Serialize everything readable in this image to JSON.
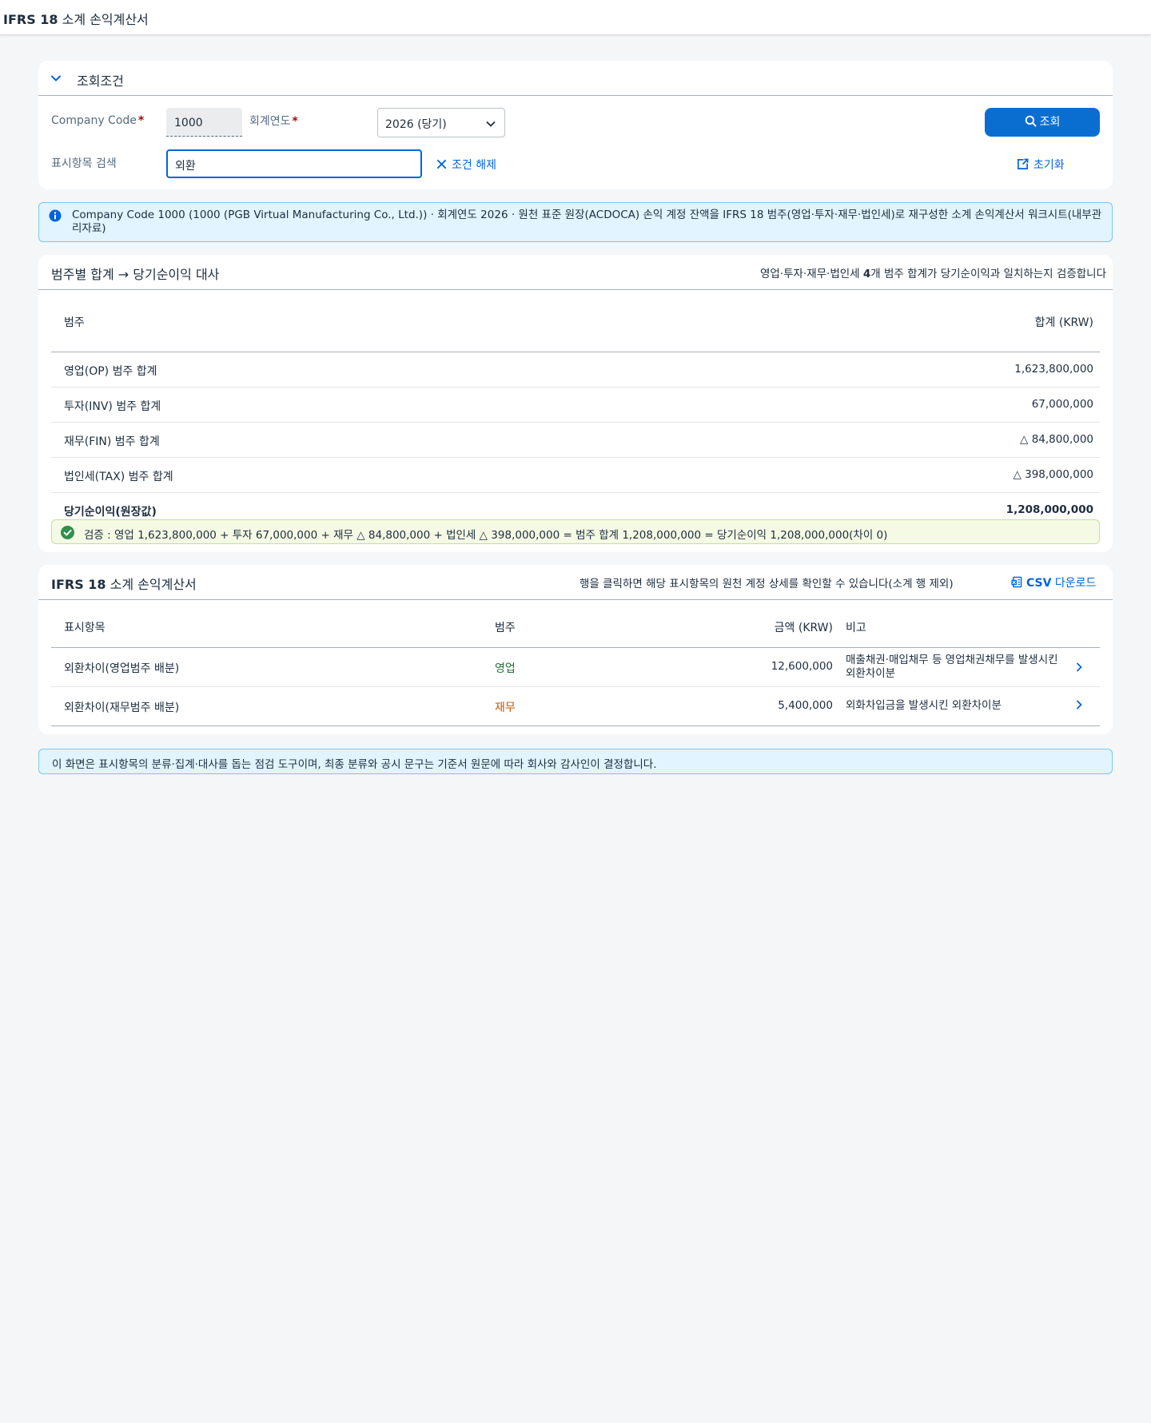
{
  "app": {
    "title_bold": "IFRS 18",
    "title_rest": "소계 손익계산서"
  },
  "filter": {
    "title": "조회조건",
    "company_code_label": "Company Code",
    "company_code_value": "1000",
    "fiscal_year_label": "회계연도",
    "fiscal_year_value": "2026 (당기)",
    "search_button_label": "조회",
    "item_search_label": "표시항목 검색",
    "item_search_value": "외환",
    "clear_label": "조건 해제",
    "reset_label": "초기화",
    "required_mark": "*"
  },
  "info": {
    "text": "Company Code 1000 (1000 (PGB Virtual Manufacturing Co., Ltd.)) · 회계연도 2026 · 원천 표준 원장(ACDOCA) 손익 계정 잔액을 IFRS 18 범주(영업·투자·재무·법인세)로 재구성한 소계 손익계산서 워크시트(내부관리자료)"
  },
  "reconciliation": {
    "title": "범주별 합계 → 당기순이익 대사",
    "note_prefix": "영업·투자·재무·법인세 ",
    "note_count": "4",
    "note_suffix": "개 범주 합계가 당기순이익과 일치하는지 검증합니다",
    "columns": {
      "category": "범주",
      "total": "합계 (KRW)"
    },
    "rows": [
      {
        "label": "영업(OP) 범주 합계",
        "value": "1,623,800,000"
      },
      {
        "label": "투자(INV) 범주 합계",
        "value": "67,000,000"
      },
      {
        "label": "재무(FIN) 범주 합계",
        "value": "△ 84,800,000"
      },
      {
        "label": "법인세(TAX) 범주 합계",
        "value": "△ 398,000,000"
      }
    ],
    "total_row": {
      "label": "당기순이익(원장값)",
      "value": "1,208,000,000"
    },
    "verification": "검증 : 영업 1,623,800,000 + 투자 67,000,000 + 재무 △ 84,800,000 + 법인세 △ 398,000,000 = 범주 합계 1,208,000,000 = 당기순이익 1,208,000,000(차이 0)"
  },
  "statement": {
    "title_bold": "IFRS 18",
    "title_rest": "소계 손익계산서",
    "note": "행을 클릭하면 해당 표시항목의 원천 계정 상세를 확인할 수 있습니다(소계 행 제외)",
    "csv_bold": "CSV",
    "csv_rest": "다운로드",
    "columns": {
      "item": "표시항목",
      "category": "범주",
      "amount": "금액 (KRW)",
      "note": "비고"
    },
    "rows": [
      {
        "item": "외환차이(영업범주 배분)",
        "category": "영업",
        "category_color": "#256f3a",
        "amount": "12,600,000",
        "note": "매출채권·매입채무 등 영업채권채무를 발생시킨 외환차이분"
      },
      {
        "item": "외환차이(재무범주 배분)",
        "category": "재무",
        "category_color": "#c35500",
        "amount": "5,400,000",
        "note": "외화차입금을 발생시킨 외환차이분"
      }
    ]
  },
  "footer": {
    "text": "이 화면은 표시항목의 분류·집계·대사를 돕는 점검 도구이며, 최종 분류와 공시 문구는 기준서 원문에 따라 회사와 감사인이 결정합니다."
  },
  "colors": {
    "accent": "#0a6ed1",
    "link": "#0064d9",
    "info_bg": "#e1f4ff",
    "success_bg": "#f5fae5",
    "success_icon": "#30914c"
  }
}
